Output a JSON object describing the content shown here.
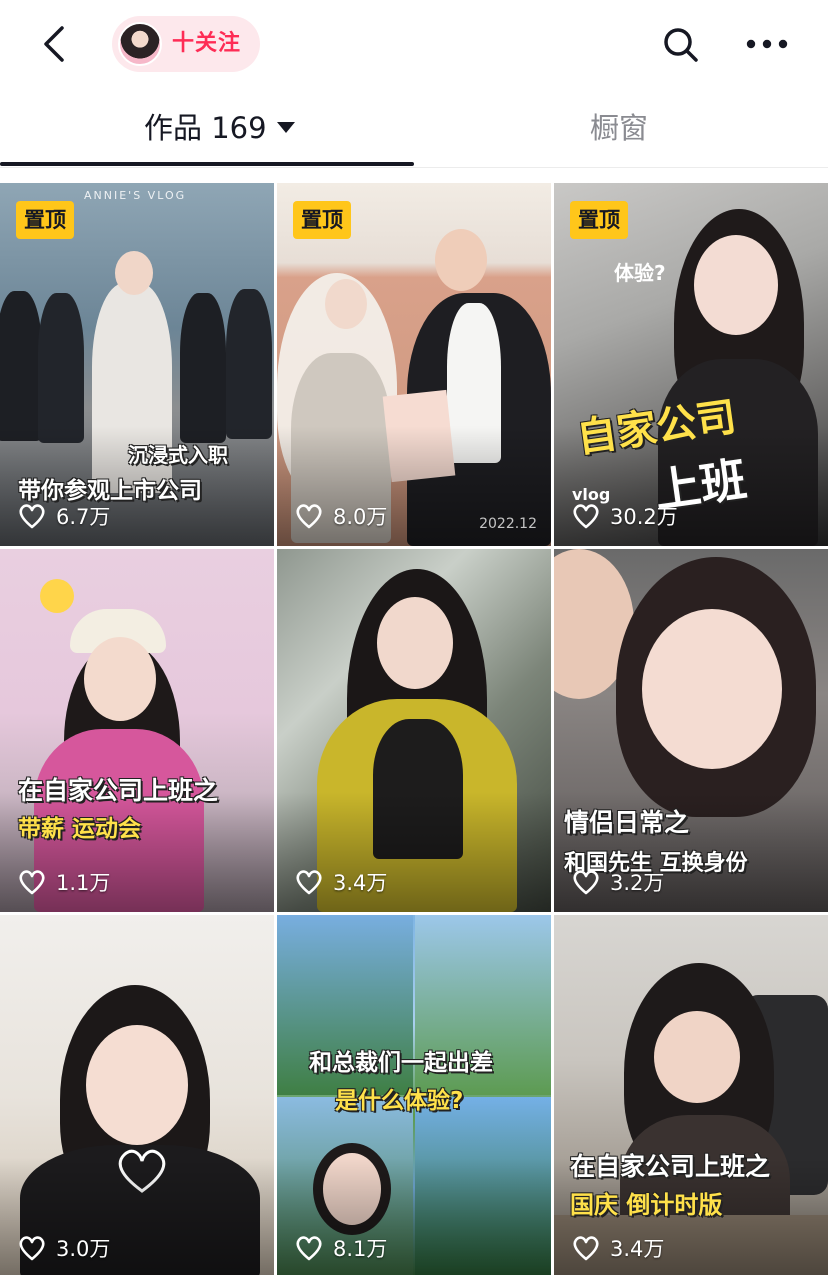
{
  "header": {
    "back_icon": "chevron-left-icon",
    "follow_label": "十关注",
    "search_icon": "search-icon",
    "more_icon": "more-horizontal-icon"
  },
  "tabs": {
    "works_label": "作品 169",
    "window_label": "橱窗",
    "active": "works"
  },
  "videos": [
    {
      "pinned": true,
      "pin_label": "置顶",
      "lines": [
        "沉浸式入职",
        "带你参观上市公司"
      ],
      "watermark": "ANNIE'S VLOG",
      "likes": "6.7万"
    },
    {
      "pinned": true,
      "pin_label": "置顶",
      "lines": [],
      "date": "2022.12",
      "likes": "8.0万"
    },
    {
      "pinned": true,
      "pin_label": "置顶",
      "lines": [
        "自家公司",
        "上班"
      ],
      "doodle": "体验?",
      "vlog_mark": "vlog",
      "likes": "30.2万"
    },
    {
      "pinned": false,
      "lines": [
        "在自家公司上班之",
        "带薪 运动会"
      ],
      "likes": "1.1万"
    },
    {
      "pinned": false,
      "lines": [],
      "likes": "3.4万"
    },
    {
      "pinned": false,
      "lines": [
        "情侣日常之",
        "和国先生   互换身份"
      ],
      "likes": "3.2万"
    },
    {
      "pinned": false,
      "lines": [],
      "likes": "3.0万"
    },
    {
      "pinned": false,
      "lines": [
        "和总裁们一起出差",
        "是什么体验?"
      ],
      "likes": "8.1万"
    },
    {
      "pinned": false,
      "lines": [
        "在自家公司上班之",
        "国庆 倒计时版"
      ],
      "likes": "3.4万"
    }
  ],
  "colors": {
    "accent": "#fe2c55",
    "pin_badge": "#ffc61a",
    "text_primary": "#161823",
    "text_secondary": "#8a8b91"
  }
}
